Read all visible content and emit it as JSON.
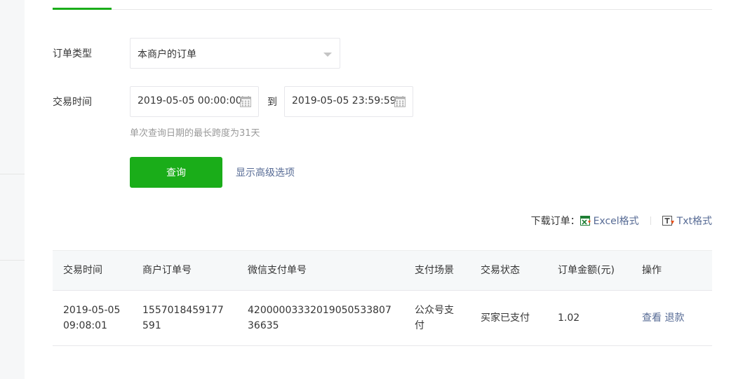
{
  "filters": {
    "order_type_label": "订单类型",
    "order_type_value": "本商户的订单",
    "trade_time_label": "交易时间",
    "start_time": "2019-05-05 00:00:00",
    "to_text": "到",
    "end_time": "2019-05-05 23:59:59",
    "hint": "单次查询日期的最长跨度为31天",
    "query_button": "查询",
    "advanced_link": "显示高级选项"
  },
  "download": {
    "label": "下载订单：",
    "excel": "Excel格式",
    "txt": "Txt格式"
  },
  "table": {
    "headers": [
      "交易时间",
      "商户订单号",
      "微信支付单号",
      "支付场景",
      "交易状态",
      "订单金额(元)",
      "操作"
    ],
    "rows": [
      {
        "time": "2019-05-05 09:08:01",
        "merchant_order_no": "1557018459177591",
        "wechat_order_no": "4200000333201905053380736635",
        "scene": "公众号支付",
        "status": "买家已支付",
        "amount": "1.02",
        "action_view": "查看",
        "action_refund": "退款"
      }
    ]
  },
  "colors": {
    "accent_green": "#1aad19",
    "link_blue": "#576b95"
  }
}
